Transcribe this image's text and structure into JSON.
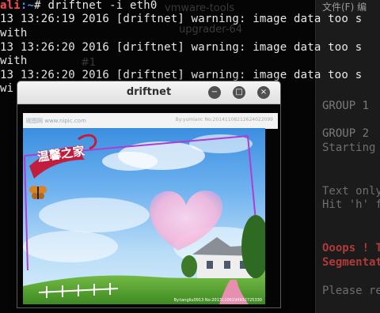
{
  "terminal": {
    "prompt_user": "ali",
    "prompt_path": "~",
    "prompt_symbol": "#",
    "command": "driftnet -i eth0",
    "lines": [
      " 13 13:26:19 2016 [driftnet] warning: image data too s",
      "with",
      " 13 13:26:20 2016 [driftnet] warning: image data too s",
      "with",
      " 13 13:26:20 2016 [driftnet] warning: image data too s",
      "wi"
    ]
  },
  "desktop": {
    "ghost_label_1": "vmware-tools",
    "ghost_label_2": "upgrader-64",
    "ghost_label_3": "#1"
  },
  "background_window": {
    "menu_label": "文件(F) 编",
    "lines": [
      "GROUP 1",
      "GROUP 2",
      "Starting",
      "Text only",
      "Hit 'h' f",
      "Ooops ! T",
      "Segmentat",
      "Please re"
    ]
  },
  "driftnet_window": {
    "title": "driftnet",
    "minimize_symbol": "−",
    "maximize_symbol": "□",
    "close_symbol": "×",
    "thumb_left_text": "昵图网 www.nipic.com",
    "thumb_right_text": "By:yumianc No:20141108212624022099",
    "image_title": "温馨之家",
    "image_meta": "By:tangliu0913 No:20131106194932725330"
  },
  "colors": {
    "prompt_user": "#ff4b4b",
    "prompt_path": "#4f8cff",
    "terminal_text": "#e8e8e8",
    "error_text": "#b03a3a"
  }
}
